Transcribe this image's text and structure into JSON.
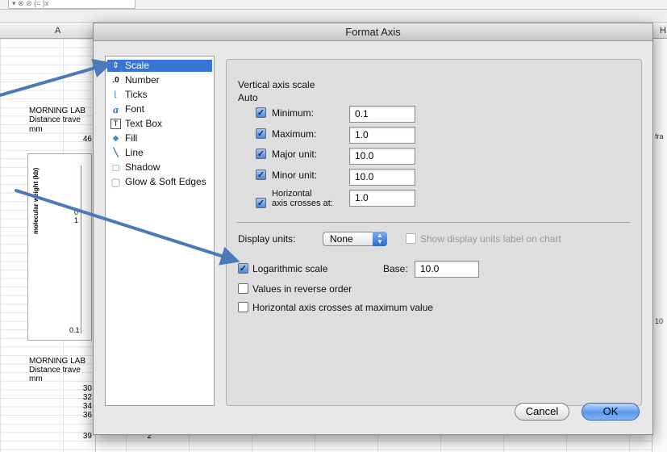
{
  "sheet": {
    "formula_hint": "▾  ⊗  ⊘  (= )x",
    "columns": [
      "A",
      "H"
    ],
    "block1": [
      "MORNING LAB",
      "Distance trave",
      "mm"
    ],
    "block1_value": "46",
    "block2": [
      "MORNING LAB",
      "Distance trave",
      "mm"
    ],
    "block2_values": [
      "30",
      "32",
      "34",
      "36",
      "39"
    ],
    "row_extra_value": "2",
    "chart_ticks": [
      "0",
      "1",
      "0.1"
    ],
    "chart_ylabel": "molecular weight (kb)",
    "right_labels": [
      "fra",
      "10"
    ]
  },
  "dialog": {
    "title": "Format Axis",
    "sidebar": [
      {
        "label": "Scale",
        "icon": "scale-icon",
        "glyph": "⇕",
        "selected": true
      },
      {
        "label": "Number",
        "icon": "number-icon",
        "glyph": ".0",
        "selected": false
      },
      {
        "label": "Ticks",
        "icon": "ticks-icon",
        "glyph": "⌊",
        "selected": false
      },
      {
        "label": "Font",
        "icon": "font-icon",
        "glyph": "a",
        "selected": false
      },
      {
        "label": "Text Box",
        "icon": "textbox-icon",
        "glyph": "T",
        "selected": false
      },
      {
        "label": "Fill",
        "icon": "fill-icon",
        "glyph": "◆",
        "selected": false
      },
      {
        "label": "Line",
        "icon": "line-icon",
        "glyph": "╲",
        "selected": false
      },
      {
        "label": "Shadow",
        "icon": "shadow-icon",
        "glyph": "□",
        "selected": false
      },
      {
        "label": "Glow & Soft Edges",
        "icon": "glow-icon",
        "glyph": "▢",
        "selected": false
      }
    ],
    "scale": {
      "heading": "Vertical axis scale",
      "auto_label": "Auto",
      "fields": [
        {
          "label": "Minimum:",
          "value": "0.1",
          "checked": true
        },
        {
          "label": "Maximum:",
          "value": "1.0",
          "checked": true
        },
        {
          "label": "Major unit:",
          "value": "10.0",
          "checked": true
        },
        {
          "label": "Minor unit:",
          "value": "10.0",
          "checked": true
        },
        {
          "label_line1": "Horizontal",
          "label_line2": "axis crosses at:",
          "value": "1.0",
          "checked": true
        }
      ],
      "display_units_label": "Display units:",
      "display_units_value": "None",
      "show_units_label": "Show display units label on chart",
      "log_label": "Logarithmic scale",
      "log_checked": true,
      "base_label": "Base:",
      "base_value": "10.0",
      "reverse_label": "Values in reverse order",
      "crosses_max_label": "Horizontal axis crosses at maximum value"
    },
    "buttons": {
      "cancel": "Cancel",
      "ok": "OK"
    }
  },
  "annotations": {
    "arrow_color": "#4a7ab8"
  }
}
